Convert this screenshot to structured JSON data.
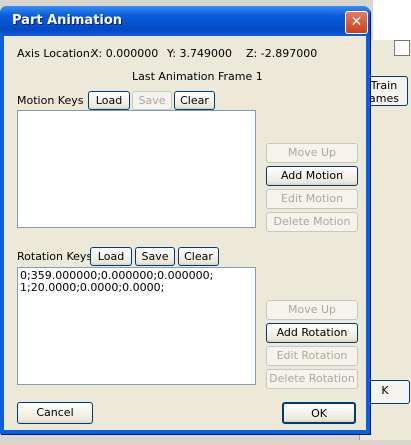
{
  "window": {
    "title": "Part Animation"
  },
  "axis": {
    "label": "Axis Location:",
    "x": "X: 0.000000",
    "y": "Y: 3.749000",
    "z": "Z: -2.897000"
  },
  "frame": {
    "text": "Last Animation Frame 1"
  },
  "motion": {
    "label": "Motion Keys",
    "load": "Load",
    "save": "Save",
    "clear": "Clear",
    "move_up": "Move Up",
    "add": "Add Motion",
    "edit": "Edit Motion",
    "delete": "Delete Motion"
  },
  "rotation": {
    "label": "Rotation Keys",
    "load": "Load",
    "save": "Save",
    "clear": "Clear",
    "lines": [
      "0;359.000000;0.000000;0.000000;",
      "1;20.0000;0.0000;0.0000;"
    ],
    "move_up": "Move Up",
    "add": "Add Rotation",
    "edit": "Edit Rotation",
    "delete": "Delete Rotation"
  },
  "footer": {
    "cancel": "Cancel",
    "ok": "OK"
  },
  "background": {
    "train_button": "Train\names",
    "k_button": "K"
  }
}
